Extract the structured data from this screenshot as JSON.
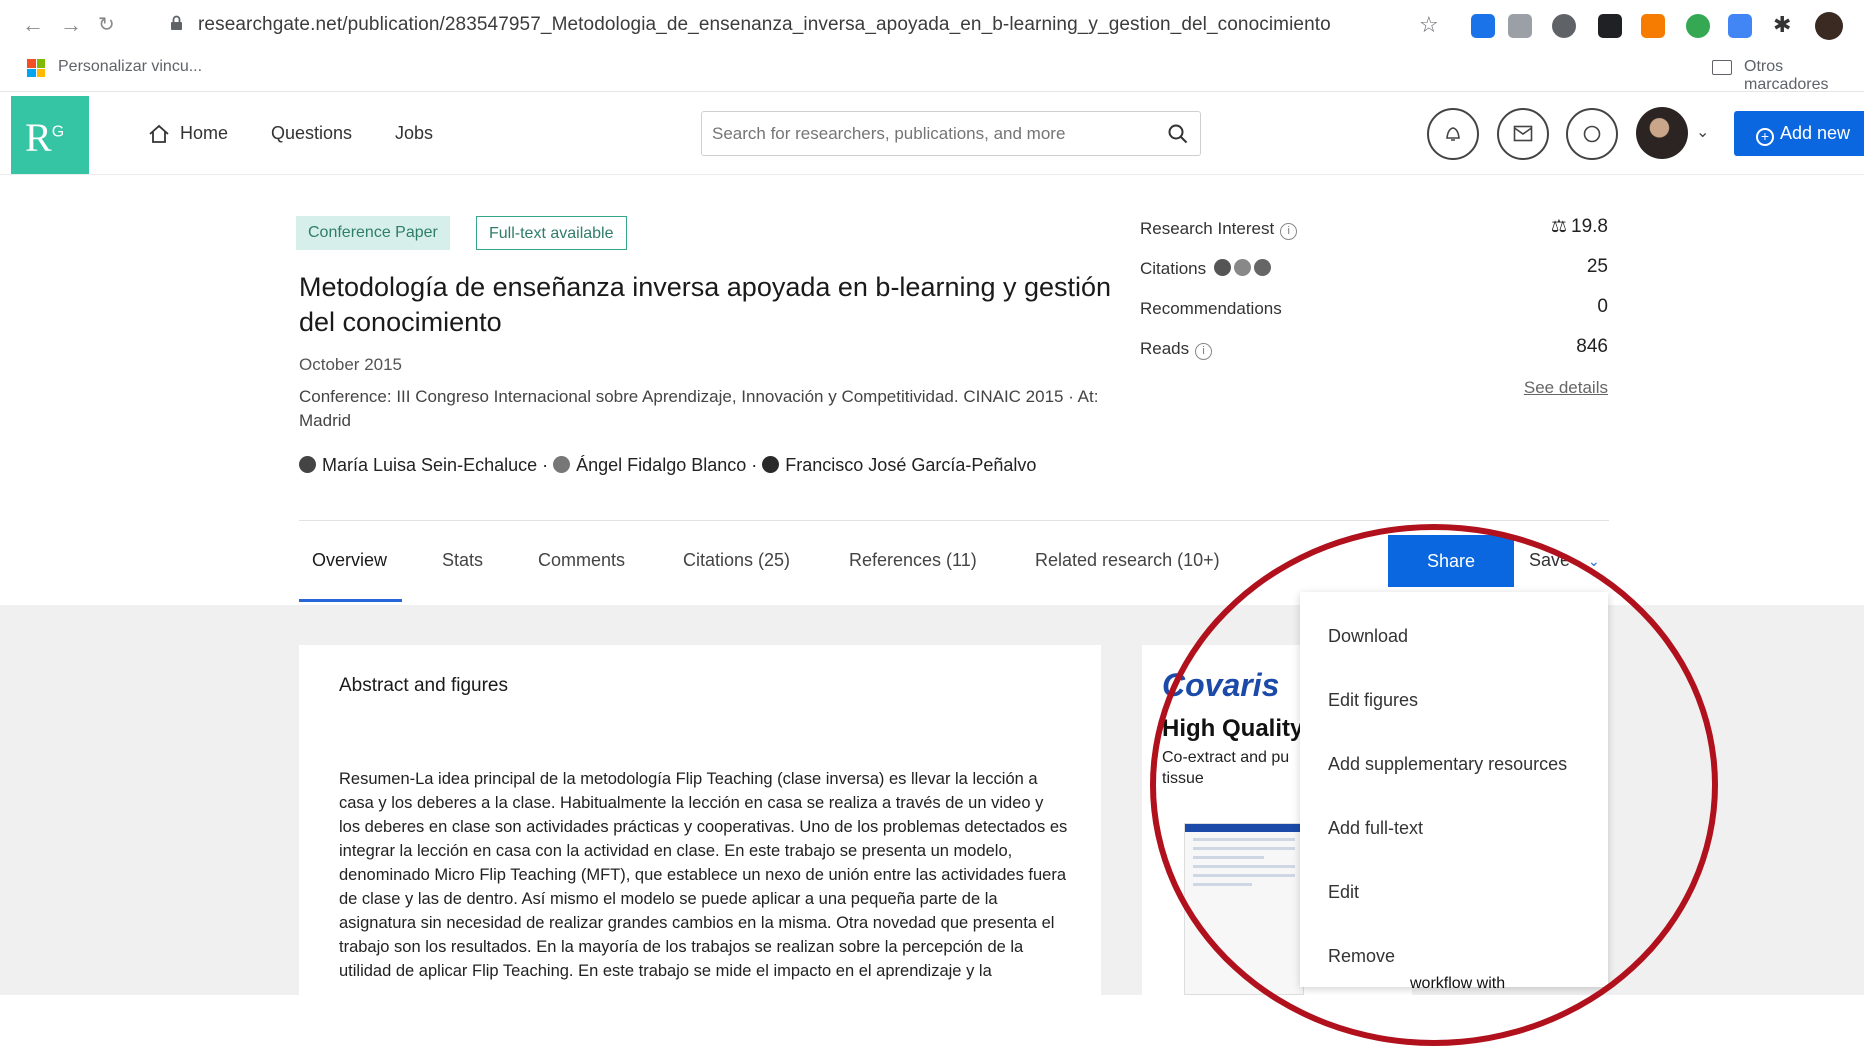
{
  "browser": {
    "url": "researchgate.net/publication/283547957_Metodologia_de_ensenanza_inversa_apoyada_en_b-learning_y_gestion_del_conocimiento",
    "bookmark_left": "Personalizar vincu...",
    "bookmark_right": "Otros marcadores",
    "extension_colors": [
      "#1a73e8",
      "#5f6368",
      "#5f6368",
      "#202124",
      "#f57c00",
      "#34a853",
      "#4285f4",
      "#333333"
    ]
  },
  "header": {
    "logo": "R",
    "logo_sup": "G",
    "nav": [
      "Home",
      "Questions",
      "Jobs"
    ],
    "search_placeholder": "Search for researchers, publications, and more",
    "add_new": "Add new"
  },
  "publication": {
    "type_tag": "Conference Paper",
    "fulltext_tag": "Full-text available",
    "title": "Metodología de enseñanza inversa apoyada en b-learning y gestión del conocimiento",
    "date": "October 2015",
    "conference": "Conference: III Congreso Internacional sobre Aprendizaje, Innovación y Competitividad. CINAIC 2015 · At: Madrid",
    "authors": [
      "María Luisa Sein-Echaluce",
      "Ángel Fidalgo Blanco",
      "Francisco José García-Peñalvo"
    ]
  },
  "stats": {
    "research_interest_label": "Research Interest",
    "research_interest_value": "19.8",
    "citations_label": "Citations",
    "citations_value": "25",
    "recommendations_label": "Recommendations",
    "recommendations_value": "0",
    "reads_label": "Reads",
    "reads_value": "846",
    "see_details": "See details"
  },
  "tabs": [
    "Overview",
    "Stats",
    "Comments",
    "Citations (25)",
    "References (11)",
    "Related research (10+)"
  ],
  "actions": {
    "share": "Share",
    "save": "Save"
  },
  "abstract": {
    "title": "Abstract and figures",
    "text": "Resumen-La idea principal de la metodología Flip Teaching (clase inversa) es llevar la lección a casa y los deberes a la clase. Habitualmente la lección en casa se realiza a través de un video y los deberes en clase son actividades prácticas y cooperativas. Uno de los problemas detectados es integrar la lección en casa con la actividad en clase. En este trabajo se presenta un modelo, denominado Micro Flip Teaching (MFT), que establece un nexo de unión entre las actividades fuera de clase y las de dentro. Así mismo el modelo se puede aplicar a una pequeña parte de la asignatura sin necesidad de realizar grandes cambios en la misma. Otra novedad que presenta el trabajo son los resultados. En la mayoría de los trabajos se realizan sobre la percepción de la utilidad de aplicar Flip Teaching. En este trabajo se mide el impacto en el aprendizaje y la"
  },
  "ad": {
    "brand": "Covaris",
    "headline": "High Quality",
    "sub": "Co-extract and pu tissue",
    "foot": "workflow with"
  },
  "menu": [
    "Download",
    "Edit figures",
    "Add supplementary resources",
    "Add full-text",
    "Edit",
    "Remove"
  ],
  "colors": {
    "rg_green": "#35c4a4",
    "primary_blue": "#0a67e0",
    "annotation_red": "#b0111c"
  }
}
